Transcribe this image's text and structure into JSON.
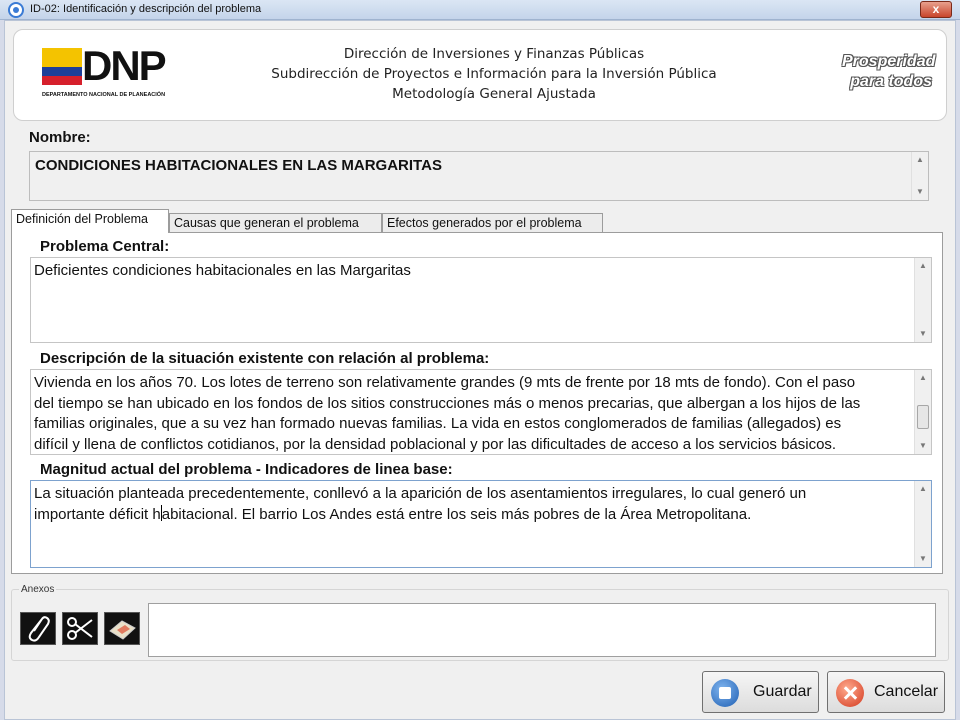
{
  "window": {
    "title": "ID-02: Identificación y descripción del problema",
    "close_label": "x"
  },
  "header": {
    "logo_text": "DNP",
    "logo_subtitle": "DEPARTAMENTO NACIONAL DE PLANEACIÓN",
    "line1": "Dirección de Inversiones y Finanzas Públicas",
    "line2": "Subdirección de Proyectos e Información para la Inversión Pública",
    "line3": "Metodología General Ajustada",
    "slogan_line1": "Prosperidad",
    "slogan_line2": "para todos"
  },
  "nombre": {
    "label": "Nombre:",
    "value": "CONDICIONES HABITACIONALES EN LAS MARGARITAS"
  },
  "tabs": [
    {
      "label": "Definición del Problema",
      "active": true
    },
    {
      "label": "Causas que generan el problema",
      "active": false
    },
    {
      "label": "Efectos generados por el problema",
      "active": false
    }
  ],
  "panel": {
    "problema_label": "Problema Central:",
    "problema_value": "Deficientes condiciones habitacionales en las Margaritas",
    "descripcion_label": "Descripción de la situación existente con relación al problema:",
    "descripcion_lines": [
      "Vivienda en los años 70. Los lotes de terreno son relativamente grandes (9 mts de frente por 18 mts de fondo). Con el paso",
      "del tiempo se han ubicado en los fondos de los sitios construcciones más o menos precarias, que albergan a los hijos de las",
      "familias originales, que a su vez han formado nuevas familias. La vida en estos conglomerados de familias (allegados) es",
      "difícil y llena de conflictos cotidianos, por la densidad poblacional y por las dificultades de acceso a los servicios básicos."
    ],
    "magnitud_label": "Magnitud actual del problema - Indicadores de linea base:",
    "magnitud_line1": "La situación planteada precedentemente, conllevó a la aparición de los asentamientos irregulares, lo cual generó un",
    "magnitud_line2_a": "importante déficit h",
    "magnitud_line2_b": "abitacional. El barrio Los Andes está entre los seis más pobres de la Área Metropolitana."
  },
  "anexos": {
    "label": "Anexos",
    "value": ""
  },
  "buttons": {
    "save": "Guardar",
    "cancel": "Cancelar"
  }
}
